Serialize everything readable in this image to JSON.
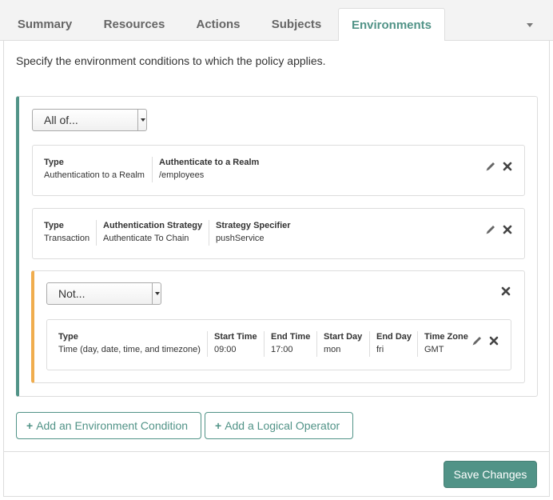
{
  "tabs": [
    {
      "label": "Summary"
    },
    {
      "label": "Resources"
    },
    {
      "label": "Actions"
    },
    {
      "label": "Subjects"
    },
    {
      "label": "Environments"
    }
  ],
  "intro_text": "Specify the environment conditions to which the policy applies.",
  "outer_operator": {
    "value": "All of..."
  },
  "conditions": [
    {
      "columns": [
        {
          "header": "Type",
          "value": "Authentication to a Realm"
        },
        {
          "header": "Authenticate to a Realm",
          "value": "/employees"
        }
      ]
    },
    {
      "columns": [
        {
          "header": "Type",
          "value": "Transaction"
        },
        {
          "header": "Authentication Strategy",
          "value": "Authenticate To Chain"
        },
        {
          "header": "Strategy Specifier",
          "value": "pushService"
        }
      ]
    }
  ],
  "nested_operator": {
    "value": "Not...",
    "condition": {
      "columns": [
        {
          "header": "Type",
          "value": "Time (day, date, time, and timezone)"
        },
        {
          "header": "Start Time",
          "value": "09:00"
        },
        {
          "header": "End Time",
          "value": "17:00"
        },
        {
          "header": "Start Day",
          "value": "mon"
        },
        {
          "header": "End Day",
          "value": "fri"
        },
        {
          "header": "Time Zone",
          "value": "GMT"
        }
      ]
    }
  },
  "buttons": {
    "add_condition": "Add an Environment Condition",
    "add_operator": "Add a Logical Operator",
    "save": "Save Changes",
    "plus": "+"
  },
  "colors": {
    "accent": "#519387",
    "nested_accent": "#f0ad4e"
  }
}
